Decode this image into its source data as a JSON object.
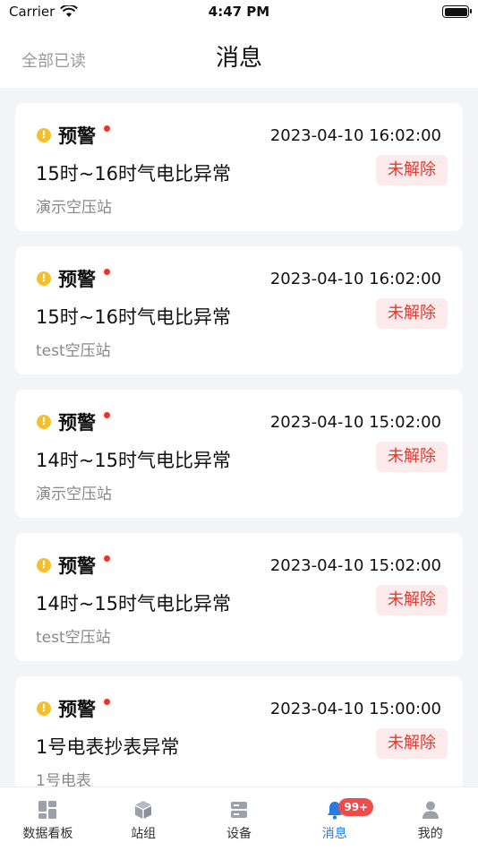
{
  "status_bar": {
    "carrier": "Carrier",
    "time": "4:47 PM"
  },
  "header": {
    "mark_all_read": "全部已读",
    "title": "消息"
  },
  "messages": [
    {
      "level": "预警",
      "time": "2023-04-10 16:02:00",
      "title": "15时~16时气电比异常",
      "source": "演示空压站",
      "status": "未解除"
    },
    {
      "level": "预警",
      "time": "2023-04-10 16:02:00",
      "title": "15时~16时气电比异常",
      "source": "test空压站",
      "status": "未解除"
    },
    {
      "level": "预警",
      "time": "2023-04-10 15:02:00",
      "title": "14时~15时气电比异常",
      "source": "演示空压站",
      "status": "未解除"
    },
    {
      "level": "预警",
      "time": "2023-04-10 15:02:00",
      "title": "14时~15时气电比异常",
      "source": "test空压站",
      "status": "未解除"
    },
    {
      "level": "预警",
      "time": "2023-04-10 15:00:00",
      "title": "1号电表抄表异常",
      "source": "1号电表",
      "status": "未解除"
    }
  ],
  "tabs": [
    {
      "label": "数据看板",
      "icon": "dashboard-icon"
    },
    {
      "label": "站组",
      "icon": "cube-icon"
    },
    {
      "label": "设备",
      "icon": "server-icon"
    },
    {
      "label": "消息",
      "icon": "bell-icon",
      "badge": "99+",
      "active": true
    },
    {
      "label": "我的",
      "icon": "user-icon"
    }
  ],
  "colors": {
    "accent": "#2a7ae4",
    "warning": "#f5c02d",
    "alert_red": "#e5372f",
    "badge_bg": "#fdeaea"
  }
}
